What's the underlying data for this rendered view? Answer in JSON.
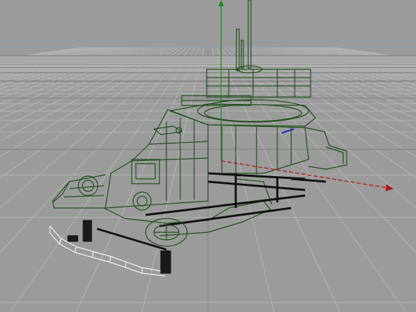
{
  "viewport": {
    "view": "perspective",
    "shading": "wireframe",
    "background_color": "#9b9b9b",
    "grid_color": "#b4b4b4",
    "grid_major_color": "#808080",
    "horizon_color": "#8ea0b4",
    "model_wire_color": "#1f4d1a",
    "selected_wire_color": "#f2f2f2",
    "gizmo": {
      "y_axis_color": "#1f8a1f",
      "x_axis_color": "#b01818",
      "z_axis_color": "#1a2fc0"
    }
  }
}
